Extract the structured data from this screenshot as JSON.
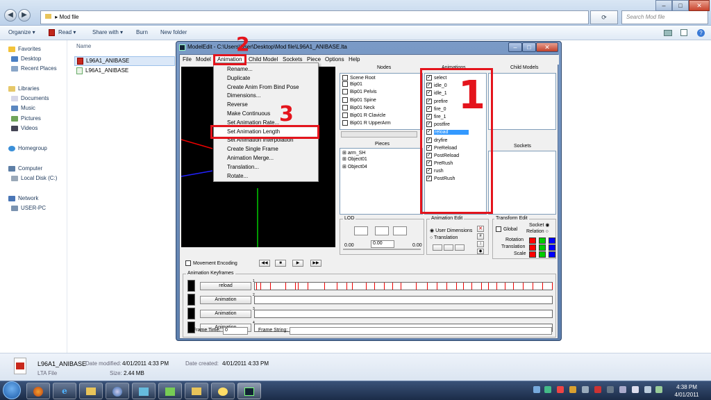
{
  "explorer": {
    "breadcrumb_sep": "▸",
    "address": "Mod file",
    "search_placeholder": "Search Mod file",
    "command_bar": {
      "organize": "Organize ▾",
      "read": "Read ▾",
      "share_with": "Share with ▾",
      "burn": "Burn",
      "new_folder": "New folder"
    },
    "column_header": "Name",
    "nav": [
      {
        "label": "Favorites"
      },
      {
        "label": "Desktop"
      },
      {
        "label": "Recent Places"
      },
      {
        "label": "Libraries"
      },
      {
        "label": "Documents"
      },
      {
        "label": "Music"
      },
      {
        "label": "Pictures"
      },
      {
        "label": "Videos"
      },
      {
        "label": "Homegroup"
      },
      {
        "label": "Computer"
      },
      {
        "label": "Local Disk (C:)"
      },
      {
        "label": "Network"
      },
      {
        "label": "USER-PC"
      }
    ],
    "files": [
      {
        "name": "L96A1_ANIBASE"
      },
      {
        "name": "L96A1_ANIBASE"
      }
    ],
    "details": {
      "filename": "L96A1_ANIBASE",
      "type": "LTA File",
      "modified_label": "Date modified:",
      "modified": "4/01/2011 4:33 PM",
      "size_label": "Size:",
      "size": "2.44 MB",
      "created_label": "Date created:",
      "created": "4/01/2011 4:33 PM"
    }
  },
  "modeledit": {
    "title": "ModelEdit - C:\\Users\\User\\Desktop\\Mod file\\L96A1_ANIBASE.lta",
    "menu": [
      "File",
      "Model",
      "Animation",
      "Child Model",
      "Sockets",
      "Piece",
      "Options",
      "Help"
    ],
    "animation_menu": [
      "Rename...",
      "Duplicate",
      "Create Anim From Bind Pose",
      "Dimensions...",
      "Reverse",
      "Make Continuous",
      "Set Animation Rate...",
      "Set Animation Length",
      "Set Animation Interpolation",
      "Create Single Frame",
      "Animation Merge...",
      "Translation...",
      "Rotate..."
    ],
    "headers": {
      "nodes": "Nodes",
      "animations": "Animations",
      "child_models": "Child Models",
      "pieces": "Pieces",
      "sockets": "Sockets",
      "lod": "LOD",
      "animation_edit": "Animation Edit",
      "transform_edit": "Transform Edit",
      "animation_keyframes": "Animation Keyframes"
    },
    "nodes": [
      "Scene Root",
      "Bip01",
      "Bip01 Pelvis",
      "Bip01 Spine",
      "Bip01 Neck",
      "Bip01 R Clavicle",
      "Bip01 R UpperArm"
    ],
    "pieces": [
      "arm_SH",
      "Object01",
      "Object04"
    ],
    "animations": [
      {
        "name": "select",
        "selected": false
      },
      {
        "name": "idle_0",
        "selected": false
      },
      {
        "name": "idle_1",
        "selected": false
      },
      {
        "name": "prefire",
        "selected": false
      },
      {
        "name": "fire_0",
        "selected": false
      },
      {
        "name": "fire_1",
        "selected": false
      },
      {
        "name": "postfire",
        "selected": false
      },
      {
        "name": "reload",
        "selected": true
      },
      {
        "name": "dryfire",
        "selected": false
      },
      {
        "name": "PreReload",
        "selected": false
      },
      {
        "name": "PostReload",
        "selected": false
      },
      {
        "name": "PreRush",
        "selected": false
      },
      {
        "name": "rush",
        "selected": false
      },
      {
        "name": "PostRush",
        "selected": false
      }
    ],
    "movement_encoding": "Movement Encoding",
    "lod": {
      "min": "0.00",
      "value": "0.00",
      "max": "0.00"
    },
    "anim_edit": {
      "user_dimensions": "User Dimensions",
      "translation": "Translation"
    },
    "transform_edit": {
      "global": "Global",
      "socket": "Socket",
      "relation": "Relation",
      "rotation": "Rotation",
      "translation": "Translation",
      "scale": "Scale",
      "colors": [
        "#ff0000",
        "#00cc00",
        "#0000ff"
      ]
    },
    "keyframes": [
      {
        "label": "reload",
        "num": "1"
      },
      {
        "label": "Animation",
        "num": "2"
      },
      {
        "label": "Animation",
        "num": "3"
      },
      {
        "label": "Animation",
        "num": "4"
      }
    ],
    "frame_time_label": "Frame Time:",
    "frame_time": "0",
    "frame_string_label": "Frame String:"
  },
  "annotations": {
    "one": "1",
    "two": "2",
    "three": "3",
    "color": "#e4141c"
  },
  "taskbar": {
    "time": "4:38 PM",
    "date": "4/01/2011"
  }
}
